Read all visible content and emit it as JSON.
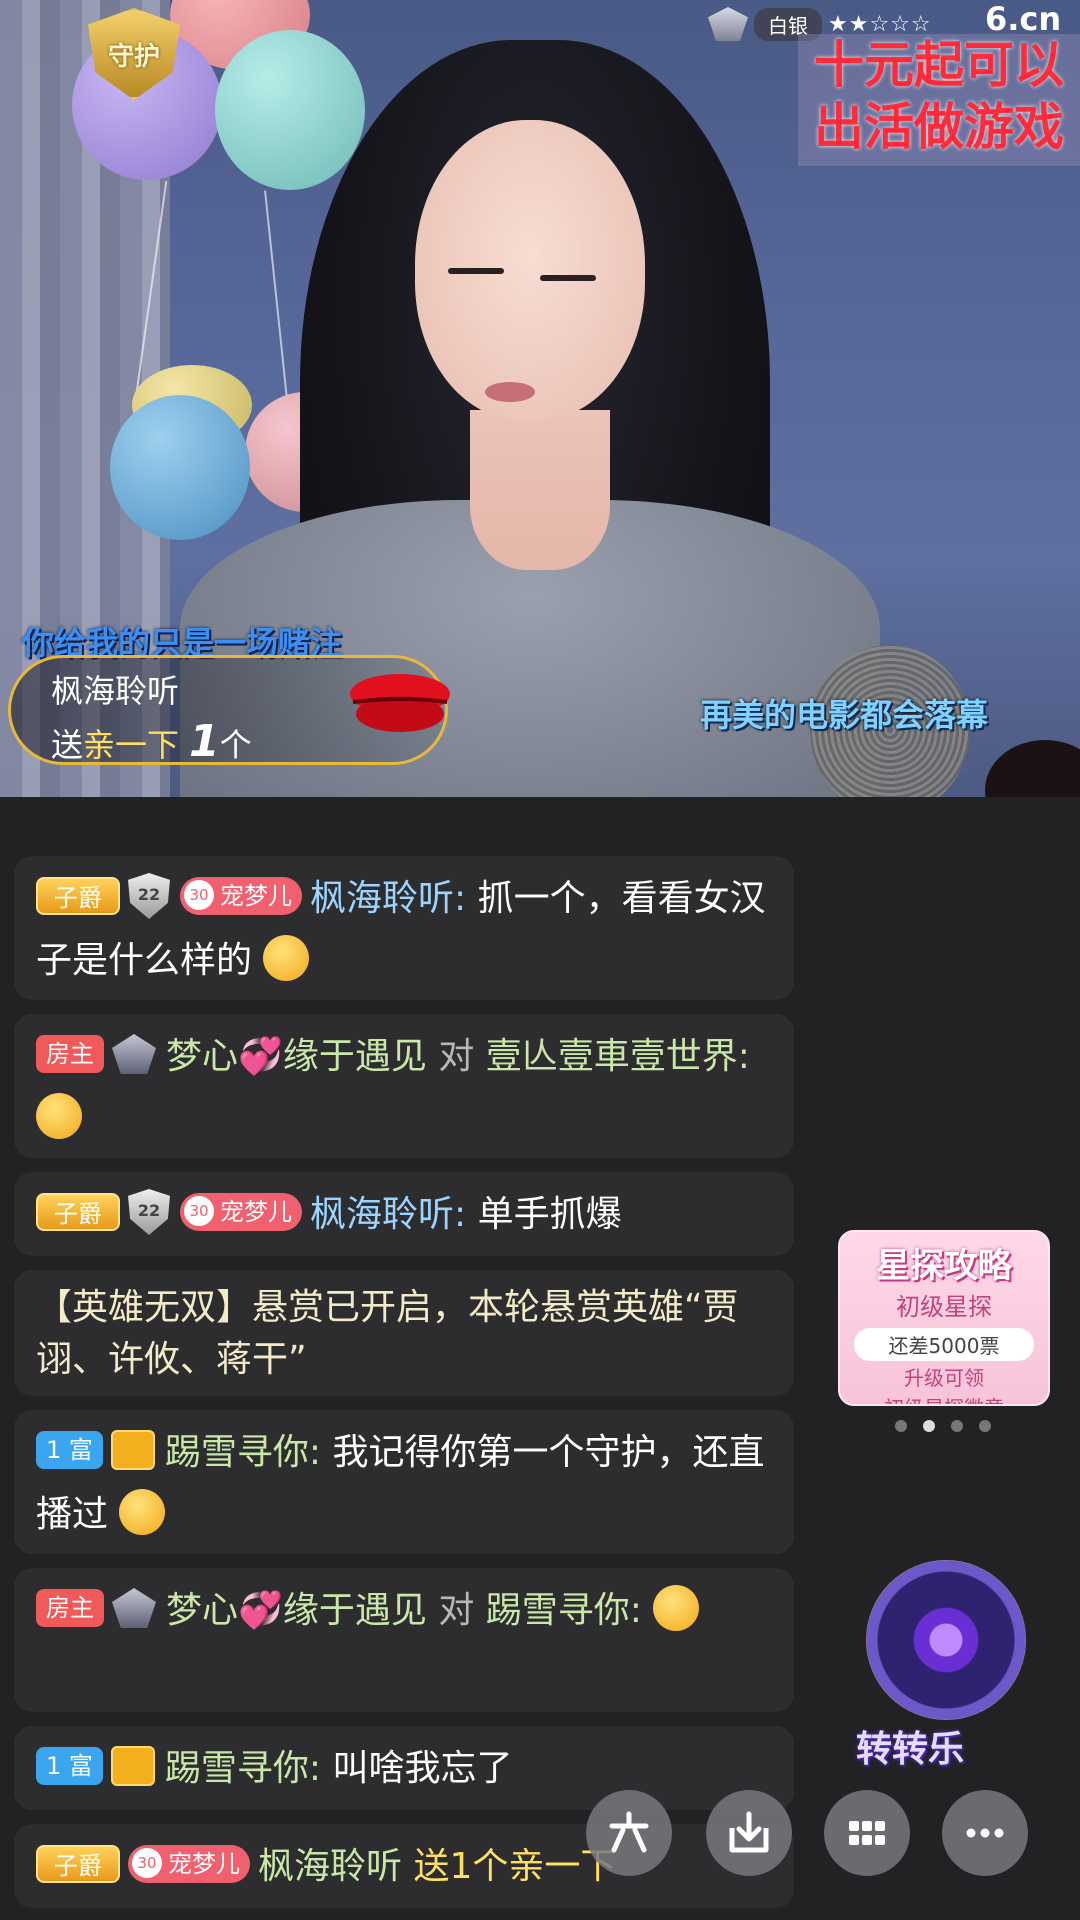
{
  "video": {
    "guard_badge": "守护",
    "rank_label": "白银",
    "rank_stars": "★★☆☆☆",
    "site_logo": "6.cn",
    "promo_line1": "十元起可以",
    "promo_line2": "出活做游戏",
    "lyric_top": "你给我的只是一场赌注",
    "lyric_bottom": "再美的电影都会落幕",
    "gift_notice": {
      "user": "枫海聆听",
      "verb": "送",
      "gift": "亲一下",
      "count": "1",
      "unit": "个"
    }
  },
  "chat": {
    "messages": [
      {
        "tags": [
          "子爵",
          "22",
          "30",
          "宠梦儿"
        ],
        "user": "枫海聆听:",
        "text": "抓一个，看看女汉子是什么样的"
      },
      {
        "tags": [
          "房主"
        ],
        "user": "梦心",
        "user2": "缘于遇见",
        "to": "对",
        "target": "壹亾壹車壹世界:"
      },
      {
        "tags": [
          "子爵",
          "22",
          "30",
          "宠梦儿"
        ],
        "user": "枫海聆听:",
        "text": "单手抓爆"
      },
      {
        "text": "【英雄无双】悬赏已开启，本轮悬赏英雄“贾诩、许攸、蒋干”"
      },
      {
        "tags": [
          "1 富"
        ],
        "user": "踢雪寻你:",
        "text": "我记得你第一个守护，还直播过"
      },
      {
        "tags": [
          "房主"
        ],
        "user": "梦心",
        "user2": "缘于遇见",
        "to": "对",
        "target": "踢雪寻你:"
      },
      {
        "tags": [
          "1 富"
        ],
        "user": "踢雪寻你:",
        "text": "叫啥我忘了"
      },
      {
        "tags": [
          "子爵",
          "30",
          "宠梦儿"
        ],
        "user": "枫海聆听",
        "text": "送1个亲一下"
      }
    ]
  },
  "widgets": {
    "strategy_title": "星探攻略",
    "strategy_level": "初级星探",
    "strategy_need": "还差5000票",
    "strategy_reward_1": "升级可领",
    "strategy_reward_2": "初级星探徽章",
    "wheel_label": "转转乐"
  },
  "bottom_bar": {
    "buttons": [
      "liu-logo",
      "download",
      "grid",
      "more"
    ]
  }
}
